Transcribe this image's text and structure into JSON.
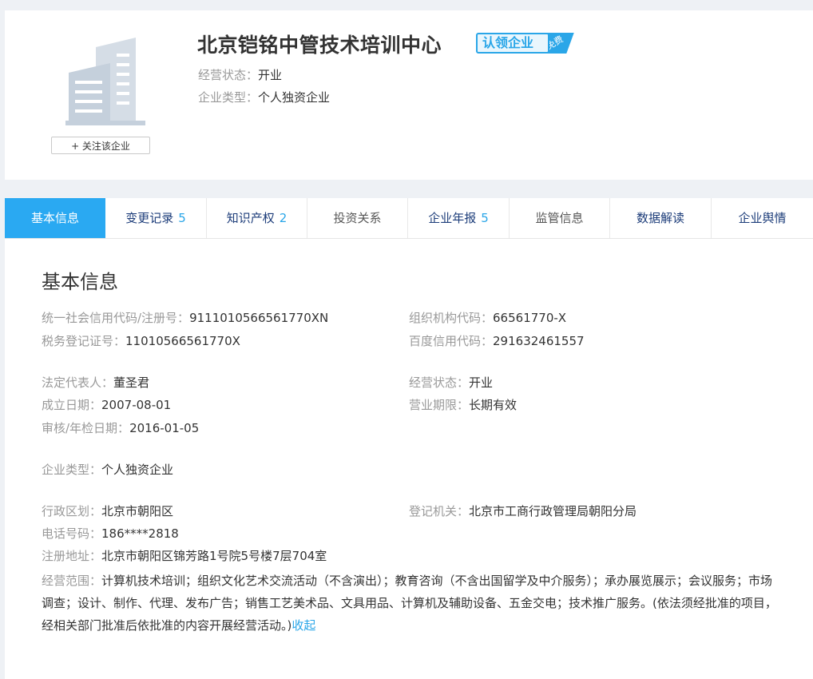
{
  "company": {
    "name": "北京铠铭中管技术培训中心",
    "badge_label": "认领企业",
    "badge_tag": "免费",
    "follow_label": "+ 关注该企业",
    "status_label": "经营状态：",
    "status_value": "开业",
    "type_label": "企业类型：",
    "type_value": "个人独资企业"
  },
  "tabs": [
    {
      "label": "基本信息",
      "count": ""
    },
    {
      "label": "变更记录",
      "count": "5"
    },
    {
      "label": "知识产权",
      "count": "2"
    },
    {
      "label": "投资关系",
      "count": ""
    },
    {
      "label": "企业年报",
      "count": "5"
    },
    {
      "label": "监管信息",
      "count": ""
    },
    {
      "label": "数据解读",
      "count": ""
    },
    {
      "label": "企业舆情",
      "count": ""
    }
  ],
  "basic": {
    "title": "基本信息",
    "credit_code_label": "统一社会信用代码/注册号：",
    "credit_code": "9111010566561770XN",
    "org_code_label": "组织机构代码：",
    "org_code": "66561770-X",
    "tax_label": "税务登记证号：",
    "tax_no": "11010566561770X",
    "baidu_label": "百度信用代码：",
    "baidu_code": "291632461557",
    "legal_label": "法定代表人：",
    "legal_rep": "董圣君",
    "status_label": "经营状态：",
    "status": "开业",
    "founded_label": "成立日期：",
    "founded": "2007-08-01",
    "term_label": "营业期限：",
    "term": "长期有效",
    "review_label": "审核/年检日期：",
    "review": "2016-01-05",
    "type_label": "企业类型：",
    "type": "个人独资企业",
    "region_label": "行政区划：",
    "region": "北京市朝阳区",
    "authority_label": "登记机关：",
    "authority": "北京市工商行政管理局朝阳分局",
    "phone_label": "电话号码：",
    "phone": "186****2818",
    "address_label": "注册地址：",
    "address": "北京市朝阳区锦芳路1号院5号楼7层704室",
    "scope_label": "经营范围：",
    "scope": "计算机技术培训；组织文化艺术交流活动（不含演出）；教育咨询（不含出国留学及中介服务）；承办展览展示；会议服务；市场调查；设计、制作、代理、发布广告；销售工艺美术品、文具用品、计算机及辅助设备、五金交电；技术推广服务。(依法须经批准的项目，经相关部门批准后依批准的内容开展经营活动。)",
    "collapse_label": "收起"
  },
  "colors": {
    "accent": "#2aa9f2",
    "nav_text": "#1d3d7a",
    "label_gray": "#999999"
  }
}
